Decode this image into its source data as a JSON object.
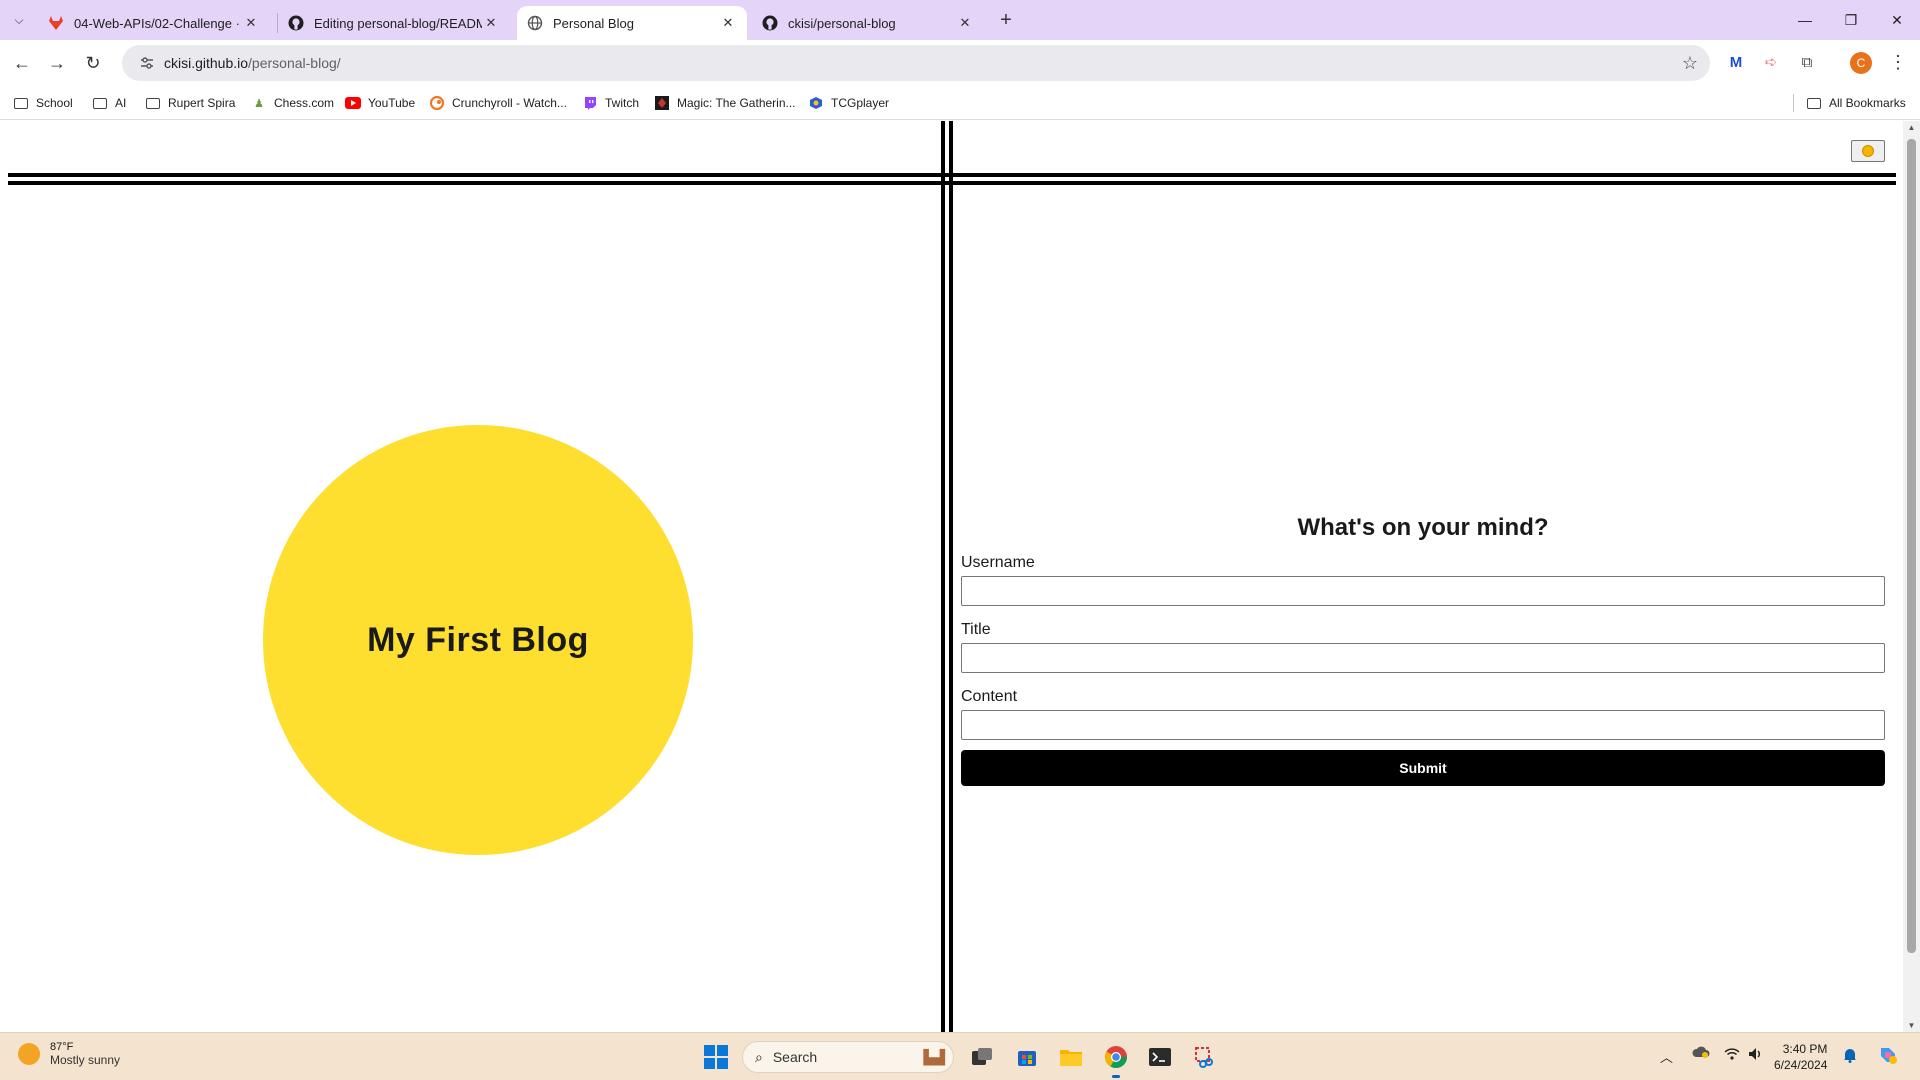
{
  "browser": {
    "tabs": [
      {
        "title": "04-Web-APIs/02-Challenge · m",
        "icon": "gitlab-icon",
        "active": false
      },
      {
        "title": "Editing personal-blog/READMI",
        "icon": "github-icon",
        "active": false
      },
      {
        "title": "Personal Blog",
        "icon": "globe-icon",
        "active": true
      },
      {
        "title": "ckisi/personal-blog",
        "icon": "github-icon",
        "active": false
      }
    ],
    "url_host": "ckisi.github.io",
    "url_path": "/personal-blog/",
    "bookmarks": [
      {
        "label": "School",
        "icon": "folder-icon"
      },
      {
        "label": "AI",
        "icon": "folder-icon"
      },
      {
        "label": "Rupert Spira",
        "icon": "folder-icon"
      },
      {
        "label": "Chess.com",
        "icon": "chess-icon"
      },
      {
        "label": "YouTube",
        "icon": "youtube-icon"
      },
      {
        "label": "Crunchyroll - Watch...",
        "icon": "crunchyroll-icon"
      },
      {
        "label": "Twitch",
        "icon": "twitch-icon"
      },
      {
        "label": "Magic: The Gatherin...",
        "icon": "magic-icon"
      },
      {
        "label": "TCGplayer",
        "icon": "tcgplayer-icon"
      }
    ],
    "all_bookmarks": "All Bookmarks",
    "profile_initial": "C"
  },
  "page": {
    "blog_title": "My First Blog",
    "form": {
      "heading": "What's on your mind?",
      "username_label": "Username",
      "title_label": "Title",
      "content_label": "Content",
      "username_value": "",
      "title_value": "",
      "content_value": "",
      "submit_label": "Submit"
    },
    "colors": {
      "circle": "#fede2f",
      "accent": "#000000"
    }
  },
  "taskbar": {
    "temperature": "87°F",
    "weather": "Mostly sunny",
    "search_placeholder": "Search",
    "time": "3:40 PM",
    "date": "6/24/2024"
  }
}
